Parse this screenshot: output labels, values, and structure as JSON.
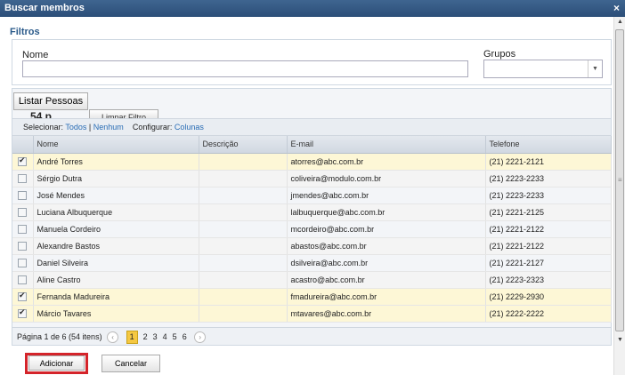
{
  "dialog": {
    "title": "Buscar membros",
    "close": "×"
  },
  "filters": {
    "title": "Filtros",
    "name_label": "Nome",
    "name_value": "",
    "groups_label": "Grupos",
    "groups_value": ""
  },
  "actions": {
    "list_label": "Listar Pessoas",
    "clear_label": "Limpar Filtro",
    "count": "54 p..."
  },
  "toolbar": {
    "select_label": "Selecionar:",
    "all": "Todos",
    "sep": "|",
    "none": "Nenhum",
    "configure_label": "Configurar:",
    "columns": "Colunas"
  },
  "table": {
    "headers": [
      "Nome",
      "Descrição",
      "E-mail",
      "Telefone"
    ],
    "rows": [
      {
        "checked": true,
        "name": "André Torres",
        "description": "",
        "email": "atorres@abc.com.br",
        "phone": "(21) 2221-2121"
      },
      {
        "checked": false,
        "name": "Sérgio Dutra",
        "description": "",
        "email": "coliveira@modulo.com.br",
        "phone": "(21) 2223-2233"
      },
      {
        "checked": false,
        "name": "José Mendes",
        "description": "",
        "email": "jmendes@abc.com.br",
        "phone": "(21) 2223-2233"
      },
      {
        "checked": false,
        "name": "Luciana Albuquerque",
        "description": "",
        "email": "lalbuquerque@abc.com.br",
        "phone": "(21) 2221-2125"
      },
      {
        "checked": false,
        "name": "Manuela Cordeiro",
        "description": "",
        "email": "mcordeiro@abc.com.br",
        "phone": "(21) 2221-2122"
      },
      {
        "checked": false,
        "name": "Alexandre Bastos",
        "description": "",
        "email": "abastos@abc.com.br",
        "phone": "(21) 2221-2122"
      },
      {
        "checked": false,
        "name": "Daniel Silveira",
        "description": "",
        "email": "dsilveira@abc.com.br",
        "phone": "(21) 2221-2127"
      },
      {
        "checked": false,
        "name": "Aline Castro",
        "description": "",
        "email": "acastro@abc.com.br",
        "phone": "(21) 2223-2323"
      },
      {
        "checked": true,
        "name": "Fernanda Madureira",
        "description": "",
        "email": "fmadureira@abc.com.br",
        "phone": "(21) 2229-2930"
      },
      {
        "checked": true,
        "name": "Márcio Tavares",
        "description": "",
        "email": "mtavares@abc.com.br",
        "phone": "(21) 2222-2222"
      }
    ]
  },
  "pager": {
    "info": "Página 1 de 6 (54 itens)",
    "prev": "‹",
    "next": "›",
    "pages": [
      "1",
      "2",
      "3",
      "4",
      "5",
      "6"
    ],
    "current": "1"
  },
  "footer": {
    "add_label": "Adicionar",
    "cancel_label": "Cancelar"
  },
  "colors": {
    "titlebar": "#2c4e78",
    "accent_link": "#2a6db5",
    "selected_row": "#fdf7d6",
    "highlight_border": "#d4242a",
    "current_page": "#f5c842"
  }
}
